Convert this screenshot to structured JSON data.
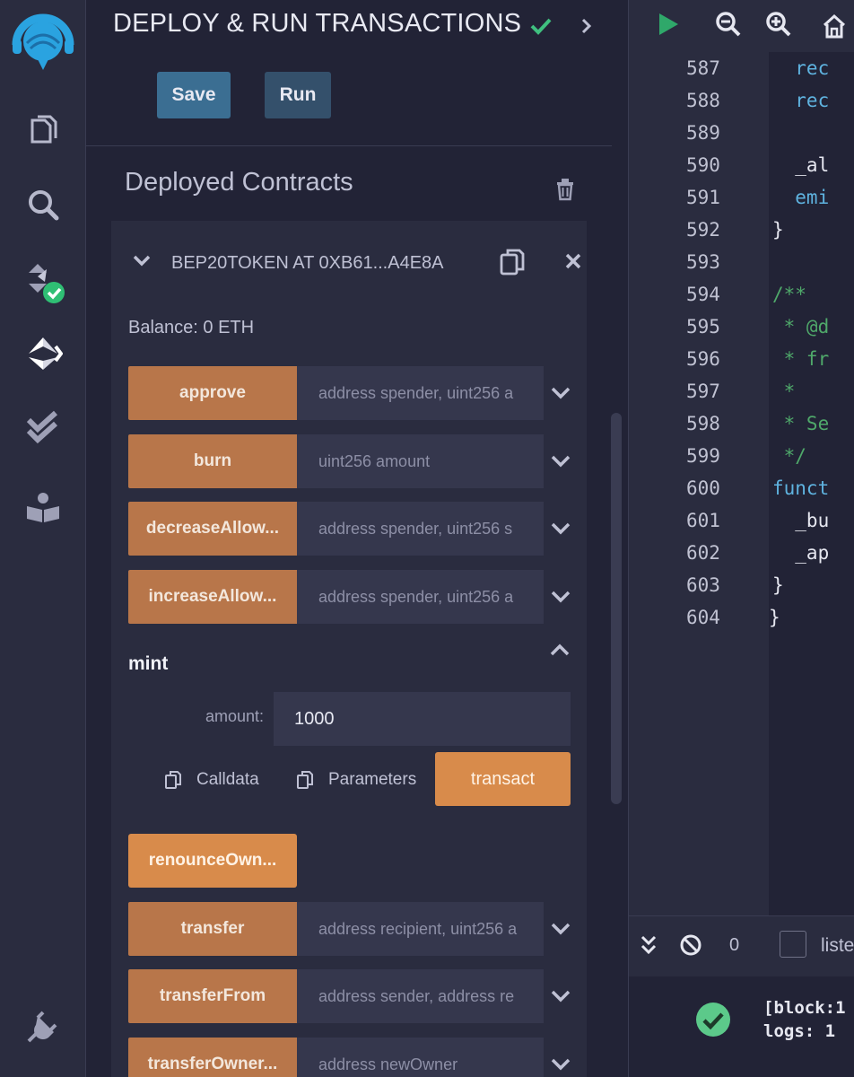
{
  "panel": {
    "title": "DEPLOY & RUN TRANSACTIONS",
    "save_label": "Save",
    "run_label": "Run",
    "deployed_title": "Deployed Contracts"
  },
  "contract": {
    "name": "BEP20TOKEN AT 0XB61...A4E8A",
    "balance": "Balance: 0 ETH",
    "functions": [
      {
        "label": "approve",
        "placeholder": "address spender, uint256 a"
      },
      {
        "label": "burn",
        "placeholder": "uint256 amount"
      },
      {
        "label": "decreaseAllow...",
        "placeholder": "address spender, uint256 s"
      },
      {
        "label": "increaseAllow...",
        "placeholder": "address spender, uint256 a"
      }
    ],
    "mint": {
      "label": "mint",
      "amount_label": "amount:",
      "amount_value": "1000",
      "calldata_label": "Calldata",
      "parameters_label": "Parameters",
      "transact_label": "transact"
    },
    "renounce_label": "renounceOwn...",
    "functions_after": [
      {
        "label": "transfer",
        "placeholder": "address recipient, uint256 a"
      },
      {
        "label": "transferFrom",
        "placeholder": "address sender, address re"
      },
      {
        "label": "transferOwner...",
        "placeholder": "address newOwner"
      }
    ]
  },
  "editor": {
    "lines": [
      {
        "n": "587",
        "code": "  rec"
      },
      {
        "n": "588",
        "code": "  rec"
      },
      {
        "n": "589",
        "code": ""
      },
      {
        "n": "590",
        "code": "  _al"
      },
      {
        "n": "591",
        "code": "  emi"
      },
      {
        "n": "592",
        "code": "}"
      },
      {
        "n": "593",
        "code": ""
      },
      {
        "n": "594",
        "code": "/**"
      },
      {
        "n": "595",
        "code": " * @d"
      },
      {
        "n": "596",
        "code": " * fr"
      },
      {
        "n": "597",
        "code": " *"
      },
      {
        "n": "598",
        "code": " * Se"
      },
      {
        "n": "599",
        "code": " */"
      },
      {
        "n": "600",
        "code": "funct"
      },
      {
        "n": "601",
        "code": "  _bu"
      },
      {
        "n": "602",
        "code": "  _ap"
      },
      {
        "n": "603",
        "code": "}"
      },
      {
        "n": "604",
        "code": "}"
      }
    ]
  },
  "terminal": {
    "count": "0",
    "listen_label": "liste",
    "log_line1": "[block:1",
    "log_line2": "logs: 1 "
  },
  "colors": {
    "accent_orange": "#d88b4b",
    "function_orange": "#b8764a",
    "success_green": "#5cc98a",
    "run_green": "#2fa86a"
  }
}
